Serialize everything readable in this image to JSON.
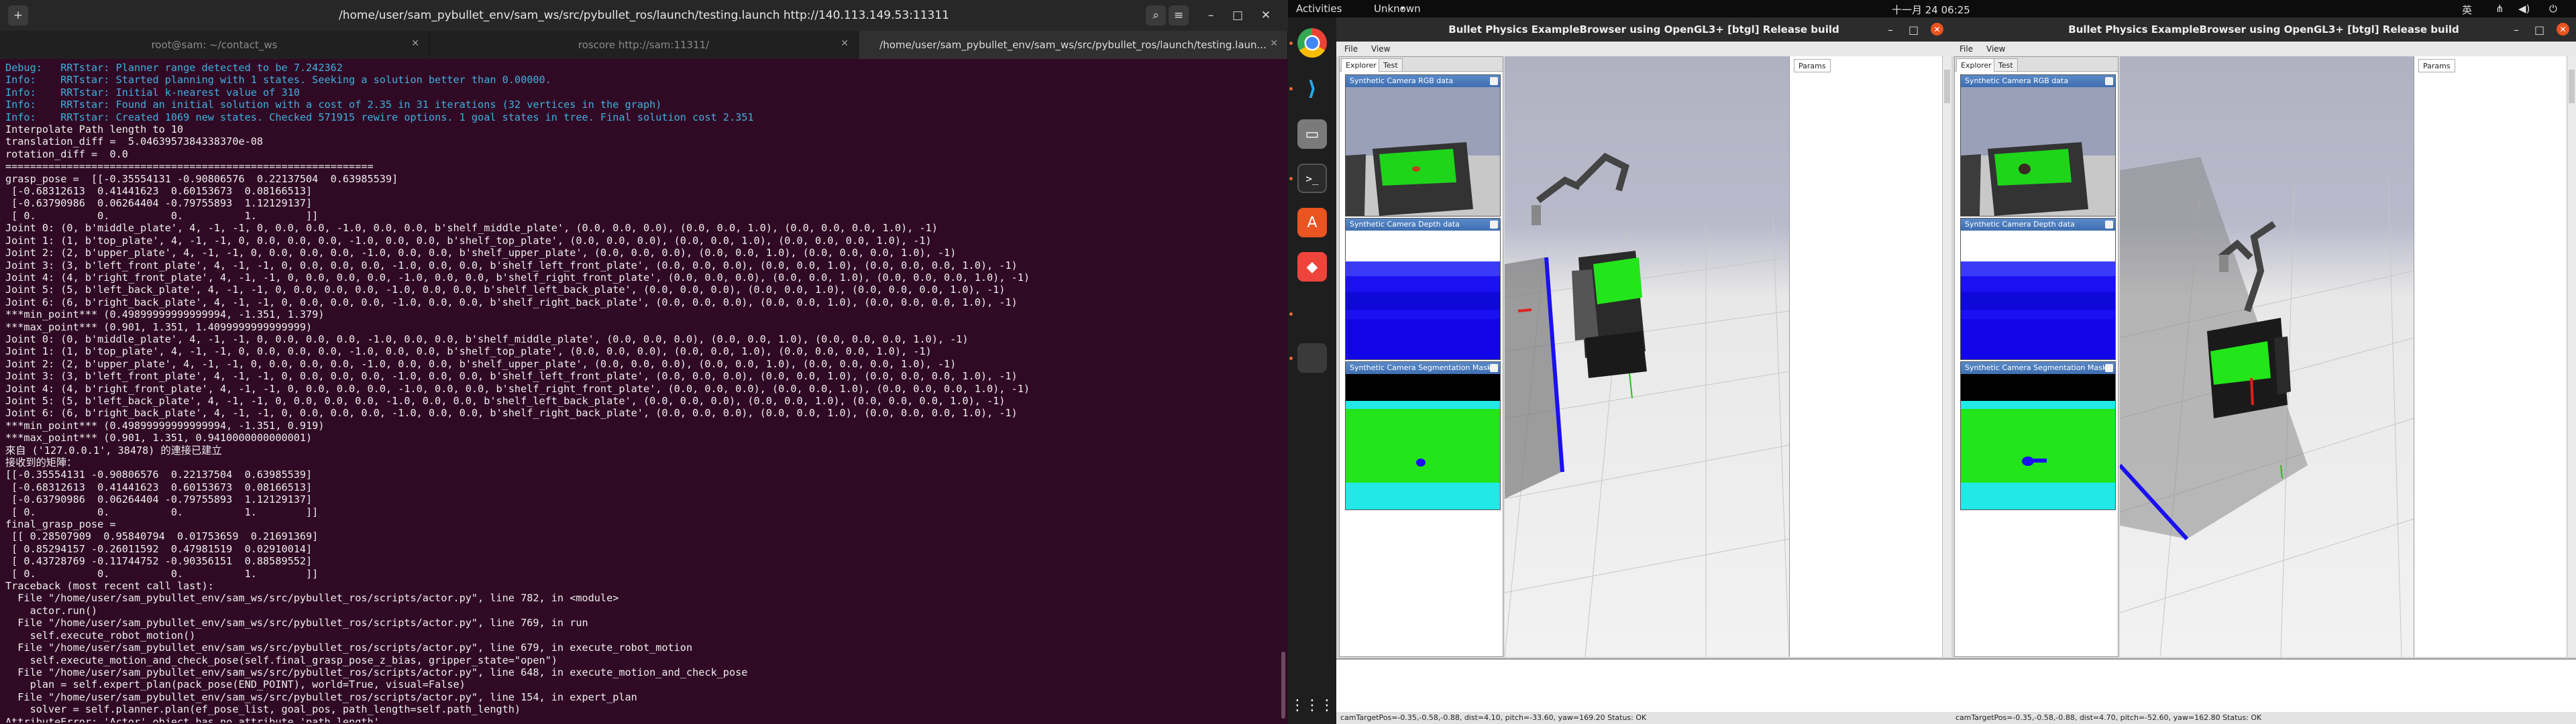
{
  "terminal": {
    "title": "/home/user/sam_pybullet_env/sam_ws/src/pybullet_ros/launch/testing.launch http://140.113.149.53:11311",
    "tabs": [
      {
        "label": "root@sam: ~/contact_ws"
      },
      {
        "label": "roscore http://sam:11311/"
      },
      {
        "label": "/home/user/sam_pybullet_env/sam_ws/src/pybullet_ros/launch/testing.laun..."
      }
    ],
    "lines": [
      {
        "t": "Debug:   RRTstar: Planner range detected to be 7.242362",
        "c": "info"
      },
      {
        "t": "Info:    RRTstar: Started planning with 1 states. Seeking a solution better than 0.00000.",
        "c": "info"
      },
      {
        "t": "Info:    RRTstar: Initial k-nearest value of 310",
        "c": "info"
      },
      {
        "t": "Info:    RRTstar: Found an initial solution with a cost of 2.35 in 31 iterations (32 vertices in the graph)",
        "c": "info"
      },
      {
        "t": "Info:    RRTstar: Created 1069 new states. Checked 571915 rewire options. 1 goal states in tree. Final solution cost 2.351",
        "c": "info"
      },
      {
        "t": "Interpolate Path length to 10",
        "c": ""
      },
      {
        "t": "translation_diff =  5.0463957384338370e-08",
        "c": ""
      },
      {
        "t": "rotation_diff =  0.0",
        "c": ""
      },
      {
        "t": "============================================================",
        "c": ""
      },
      {
        "t": "grasp_pose =  [[-0.35554131 -0.90806576  0.22137504  0.63985539]",
        "c": ""
      },
      {
        "t": " [-0.68312613  0.41441623  0.60153673  0.08166513]",
        "c": ""
      },
      {
        "t": " [-0.63790986  0.06264404 -0.79755893  1.12129137]",
        "c": ""
      },
      {
        "t": " [ 0.          0.          0.          1.        ]]",
        "c": ""
      },
      {
        "t": "Joint 0: (0, b'middle_plate', 4, -1, -1, 0, 0.0, 0.0, -1.0, 0.0, 0.0, b'shelf_middle_plate', (0.0, 0.0, 0.0), (0.0, 0.0, 1.0), (0.0, 0.0, 0.0, 1.0), -1)",
        "c": ""
      },
      {
        "t": "Joint 1: (1, b'top_plate', 4, -1, -1, 0, 0.0, 0.0, 0.0, -1.0, 0.0, 0.0, b'shelf_top_plate', (0.0, 0.0, 0.0), (0.0, 0.0, 1.0), (0.0, 0.0, 0.0, 1.0), -1)",
        "c": ""
      },
      {
        "t": "Joint 2: (2, b'upper_plate', 4, -1, -1, 0, 0.0, 0.0, 0.0, -1.0, 0.0, 0.0, b'shelf_upper_plate', (0.0, 0.0, 0.0), (0.0, 0.0, 1.0), (0.0, 0.0, 0.0, 1.0), -1)",
        "c": ""
      },
      {
        "t": "Joint 3: (3, b'left_front_plate', 4, -1, -1, 0, 0.0, 0.0, 0.0, -1.0, 0.0, 0.0, b'shelf_left_front_plate', (0.0, 0.0, 0.0), (0.0, 0.0, 1.0), (0.0, 0.0, 0.0, 1.0), -1)",
        "c": ""
      },
      {
        "t": "Joint 4: (4, b'right_front_plate', 4, -1, -1, 0, 0.0, 0.0, 0.0, -1.0, 0.0, 0.0, b'shelf_right_front_plate', (0.0, 0.0, 0.0), (0.0, 0.0, 1.0), (0.0, 0.0, 0.0, 1.0), -1)",
        "c": ""
      },
      {
        "t": "Joint 5: (5, b'left_back_plate', 4, -1, -1, 0, 0.0, 0.0, 0.0, -1.0, 0.0, 0.0, b'shelf_left_back_plate', (0.0, 0.0, 0.0), (0.0, 0.0, 1.0), (0.0, 0.0, 0.0, 1.0), -1)",
        "c": ""
      },
      {
        "t": "Joint 6: (6, b'right_back_plate', 4, -1, -1, 0, 0.0, 0.0, 0.0, -1.0, 0.0, 0.0, b'shelf_right_back_plate', (0.0, 0.0, 0.0), (0.0, 0.0, 1.0), (0.0, 0.0, 0.0, 1.0), -1)",
        "c": ""
      },
      {
        "t": "***min_point*** (0.49899999999999994, -1.351, 1.379)",
        "c": ""
      },
      {
        "t": "***max_point*** (0.901, 1.351, 1.4099999999999999)",
        "c": ""
      },
      {
        "t": "Joint 0: (0, b'middle_plate', 4, -1, -1, 0, 0.0, 0.0, 0.0, -1.0, 0.0, 0.0, b'shelf_middle_plate', (0.0, 0.0, 0.0), (0.0, 0.0, 1.0), (0.0, 0.0, 0.0, 1.0), -1)",
        "c": ""
      },
      {
        "t": "Joint 1: (1, b'top_plate', 4, -1, -1, 0, 0.0, 0.0, 0.0, -1.0, 0.0, 0.0, b'shelf_top_plate', (0.0, 0.0, 0.0), (0.0, 0.0, 1.0), (0.0, 0.0, 0.0, 1.0), -1)",
        "c": ""
      },
      {
        "t": "Joint 2: (2, b'upper_plate', 4, -1, -1, 0, 0.0, 0.0, 0.0, -1.0, 0.0, 0.0, b'shelf_upper_plate', (0.0, 0.0, 0.0), (0.0, 0.0, 1.0), (0.0, 0.0, 0.0, 1.0), -1)",
        "c": ""
      },
      {
        "t": "Joint 3: (3, b'left_front_plate', 4, -1, -1, 0, 0.0, 0.0, 0.0, -1.0, 0.0, 0.0, b'shelf_left_front_plate', (0.0, 0.0, 0.0), (0.0, 0.0, 1.0), (0.0, 0.0, 0.0, 1.0), -1)",
        "c": ""
      },
      {
        "t": "Joint 4: (4, b'right_front_plate', 4, -1, -1, 0, 0.0, 0.0, 0.0, -1.0, 0.0, 0.0, b'shelf_right_front_plate', (0.0, 0.0, 0.0), (0.0, 0.0, 1.0), (0.0, 0.0, 0.0, 1.0), -1)",
        "c": ""
      },
      {
        "t": "Joint 5: (5, b'left_back_plate', 4, -1, -1, 0, 0.0, 0.0, 0.0, -1.0, 0.0, 0.0, b'shelf_left_back_plate', (0.0, 0.0, 0.0), (0.0, 0.0, 1.0), (0.0, 0.0, 0.0, 1.0), -1)",
        "c": ""
      },
      {
        "t": "Joint 6: (6, b'right_back_plate', 4, -1, -1, 0, 0.0, 0.0, 0.0, -1.0, 0.0, 0.0, b'shelf_right_back_plate', (0.0, 0.0, 0.0), (0.0, 0.0, 1.0), (0.0, 0.0, 0.0, 1.0), -1)",
        "c": ""
      },
      {
        "t": "***min_point*** (0.49899999999999994, -1.351, 0.919)",
        "c": ""
      },
      {
        "t": "***max_point*** (0.901, 1.351, 0.9410000000000001)",
        "c": ""
      },
      {
        "t": "來自 ('127.0.0.1', 38478) 的連接已建立",
        "c": ""
      },
      {
        "t": "接收到的矩陣：",
        "c": ""
      },
      {
        "t": "[[-0.35554131 -0.90806576  0.22137504  0.63985539]",
        "c": ""
      },
      {
        "t": " [-0.68312613  0.41441623  0.60153673  0.08166513]",
        "c": ""
      },
      {
        "t": " [-0.63790986  0.06264404 -0.79755893  1.12129137]",
        "c": ""
      },
      {
        "t": " [ 0.          0.          0.          1.        ]]",
        "c": ""
      },
      {
        "t": "final_grasp_pose =",
        "c": ""
      },
      {
        "t": " [[ 0.28507909  0.95840794  0.01753659  0.21691369]",
        "c": ""
      },
      {
        "t": " [ 0.85294157 -0.26011592  0.47981519  0.02910014]",
        "c": ""
      },
      {
        "t": " [ 0.43728769 -0.11744752 -0.90356151  0.88589552]",
        "c": ""
      },
      {
        "t": " [ 0.          0.          0.          1.        ]]",
        "c": ""
      },
      {
        "t": "Traceback (most recent call last):",
        "c": ""
      },
      {
        "t": "  File \"/home/user/sam_pybullet_env/sam_ws/src/pybullet_ros/scripts/actor.py\", line 782, in <module>",
        "c": ""
      },
      {
        "t": "    actor.run()",
        "c": ""
      },
      {
        "t": "  File \"/home/user/sam_pybullet_env/sam_ws/src/pybullet_ros/scripts/actor.py\", line 769, in run",
        "c": ""
      },
      {
        "t": "    self.execute_robot_motion()",
        "c": ""
      },
      {
        "t": "  File \"/home/user/sam_pybullet_env/sam_ws/src/pybullet_ros/scripts/actor.py\", line 679, in execute_robot_motion",
        "c": ""
      },
      {
        "t": "    self.execute_motion_and_check_pose(self.final_grasp_pose_z_bias, gripper_state=\"open\")",
        "c": ""
      },
      {
        "t": "  File \"/home/user/sam_pybullet_env/sam_ws/src/pybullet_ros/scripts/actor.py\", line 648, in execute_motion_and_check_pose",
        "c": ""
      },
      {
        "t": "    plan = self.expert_plan(pack_pose(END_POINT), world=True, visual=False)",
        "c": ""
      },
      {
        "t": "  File \"/home/user/sam_pybullet_env/sam_ws/src/pybullet_ros/scripts/actor.py\", line 154, in expert_plan",
        "c": ""
      },
      {
        "t": "    solver = self.planner.plan(ef_pose_list, goal_pos, path_length=self.path_length)",
        "c": ""
      },
      {
        "t": "AttributeError: 'Actor' object has no attribute 'path_length'",
        "c": "err"
      }
    ]
  },
  "topbar": {
    "activities": "Activities",
    "app_menu": "Unknown",
    "clock": "十一月 24 06:25"
  },
  "dock": [
    {
      "icon": "chrome-icon"
    },
    {
      "icon": "vscode-icon"
    },
    {
      "icon": "files-icon"
    },
    {
      "icon": "terminal-icon"
    },
    {
      "icon": "software-store-icon"
    },
    {
      "icon": "anydesk-icon"
    },
    {
      "icon": "active-window-icon"
    },
    {
      "icon": "show-apps-icon"
    }
  ],
  "bullet_windows": [
    {
      "title": "Bullet Physics ExampleBrowser using OpenGL3+ [btgl] Release build",
      "menu": [
        "File",
        "View"
      ],
      "explorer_tabs": [
        "Explorer",
        "Test"
      ],
      "params_tab": "Params",
      "cameras": [
        "Synthetic Camera RGB data",
        "Synthetic Camera Depth data",
        "Synthetic Camera Segmentation Mask"
      ],
      "status": "camTargetPos=-0.35,-0.58,-0.88, dist=4.10, pitch=-33.60, yaw=169.20  Status: OK"
    },
    {
      "title": "Bullet Physics ExampleBrowser using OpenGL3+ [btgl] Release build",
      "menu": [
        "File",
        "View"
      ],
      "explorer_tabs": [
        "Explorer",
        "Test"
      ],
      "params_tab": "Params",
      "cameras": [
        "Synthetic Camera RGB data",
        "Synthetic Camera Depth data",
        "Synthetic Camera Segmentation Mask"
      ],
      "status": "camTargetPos=-0.35,-0.58,-0.88, dist=4.70, pitch=-52.60, yaw=162.80  Status: OK"
    }
  ],
  "colors": {
    "terminal_bg": "#300a24",
    "info_text": "#3fb0e0",
    "accent_orange": "#e95420",
    "sim_green": "#22e51a",
    "sim_blue": "#1a10f0",
    "sim_cyan": "#22e8e8"
  }
}
